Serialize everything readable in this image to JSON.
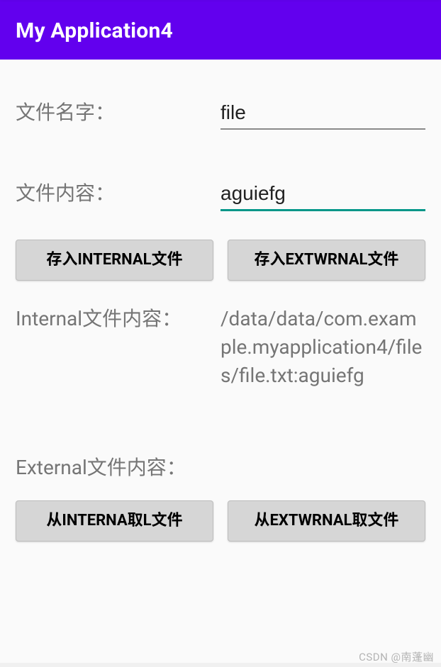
{
  "appbar": {
    "title": "My Application4"
  },
  "form": {
    "filename_label": "文件名字：",
    "filename_value": "file",
    "content_label": "文件内容：",
    "content_value": "aguiefg"
  },
  "buttons": {
    "save_internal": "存入INTERNAL文件",
    "save_external": "存入EXTWRNAL文件",
    "read_internal": "从INTERNA取L文件",
    "read_external": "从EXTWRNAL取文件"
  },
  "output": {
    "internal_label": "Internal文件内容：",
    "internal_value": "/data/data/com.example.myapplication4/files/file.txt:aguiefg",
    "external_label": "External文件内容："
  },
  "watermark": "CSDN @南蓬幽"
}
